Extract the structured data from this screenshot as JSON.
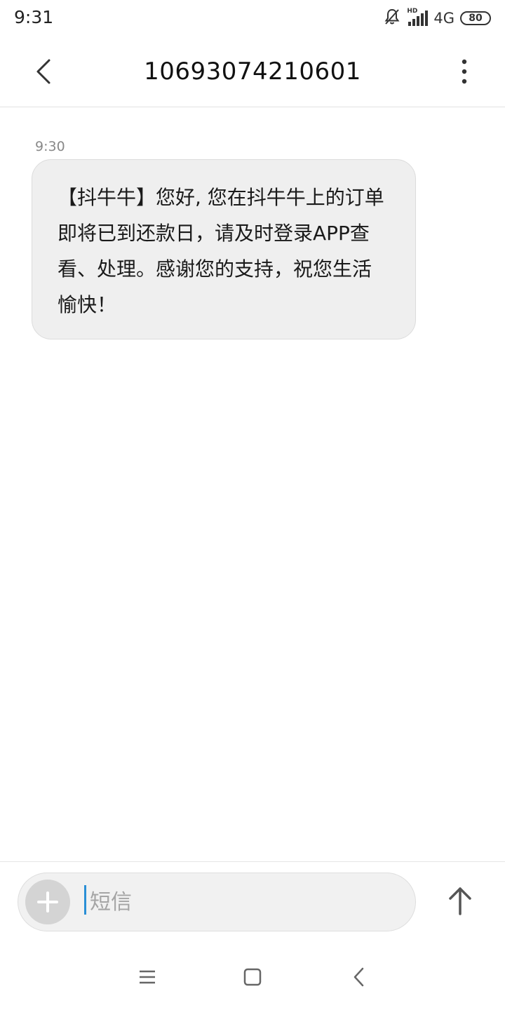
{
  "status_bar": {
    "time": "9:31",
    "network": "4G",
    "signal_hd": "HD",
    "battery": "80",
    "icons": [
      "bell-muted-icon",
      "signal-icon",
      "battery-icon"
    ]
  },
  "header": {
    "title": "10693074210601",
    "back_icon": "chevron-left-icon",
    "more_icon": "more-vertical-icon"
  },
  "conversation": {
    "messages": [
      {
        "time": "9:30",
        "text": "【抖牛牛】您好, 您在抖牛牛上的订单即将已到还款日，请及时登录APP查看、处理。感谢您的支持，祝您生活愉快！"
      }
    ]
  },
  "composer": {
    "placeholder": "短信",
    "value": "",
    "add_icon": "plus-icon",
    "send_icon": "arrow-up-icon"
  },
  "nav_bar": {
    "icons": [
      "menu-icon",
      "home-square-icon",
      "back-icon"
    ]
  },
  "colors": {
    "bubble_bg": "#efefef",
    "cursor": "#2a8fd6",
    "icon_gray": "#555555"
  }
}
